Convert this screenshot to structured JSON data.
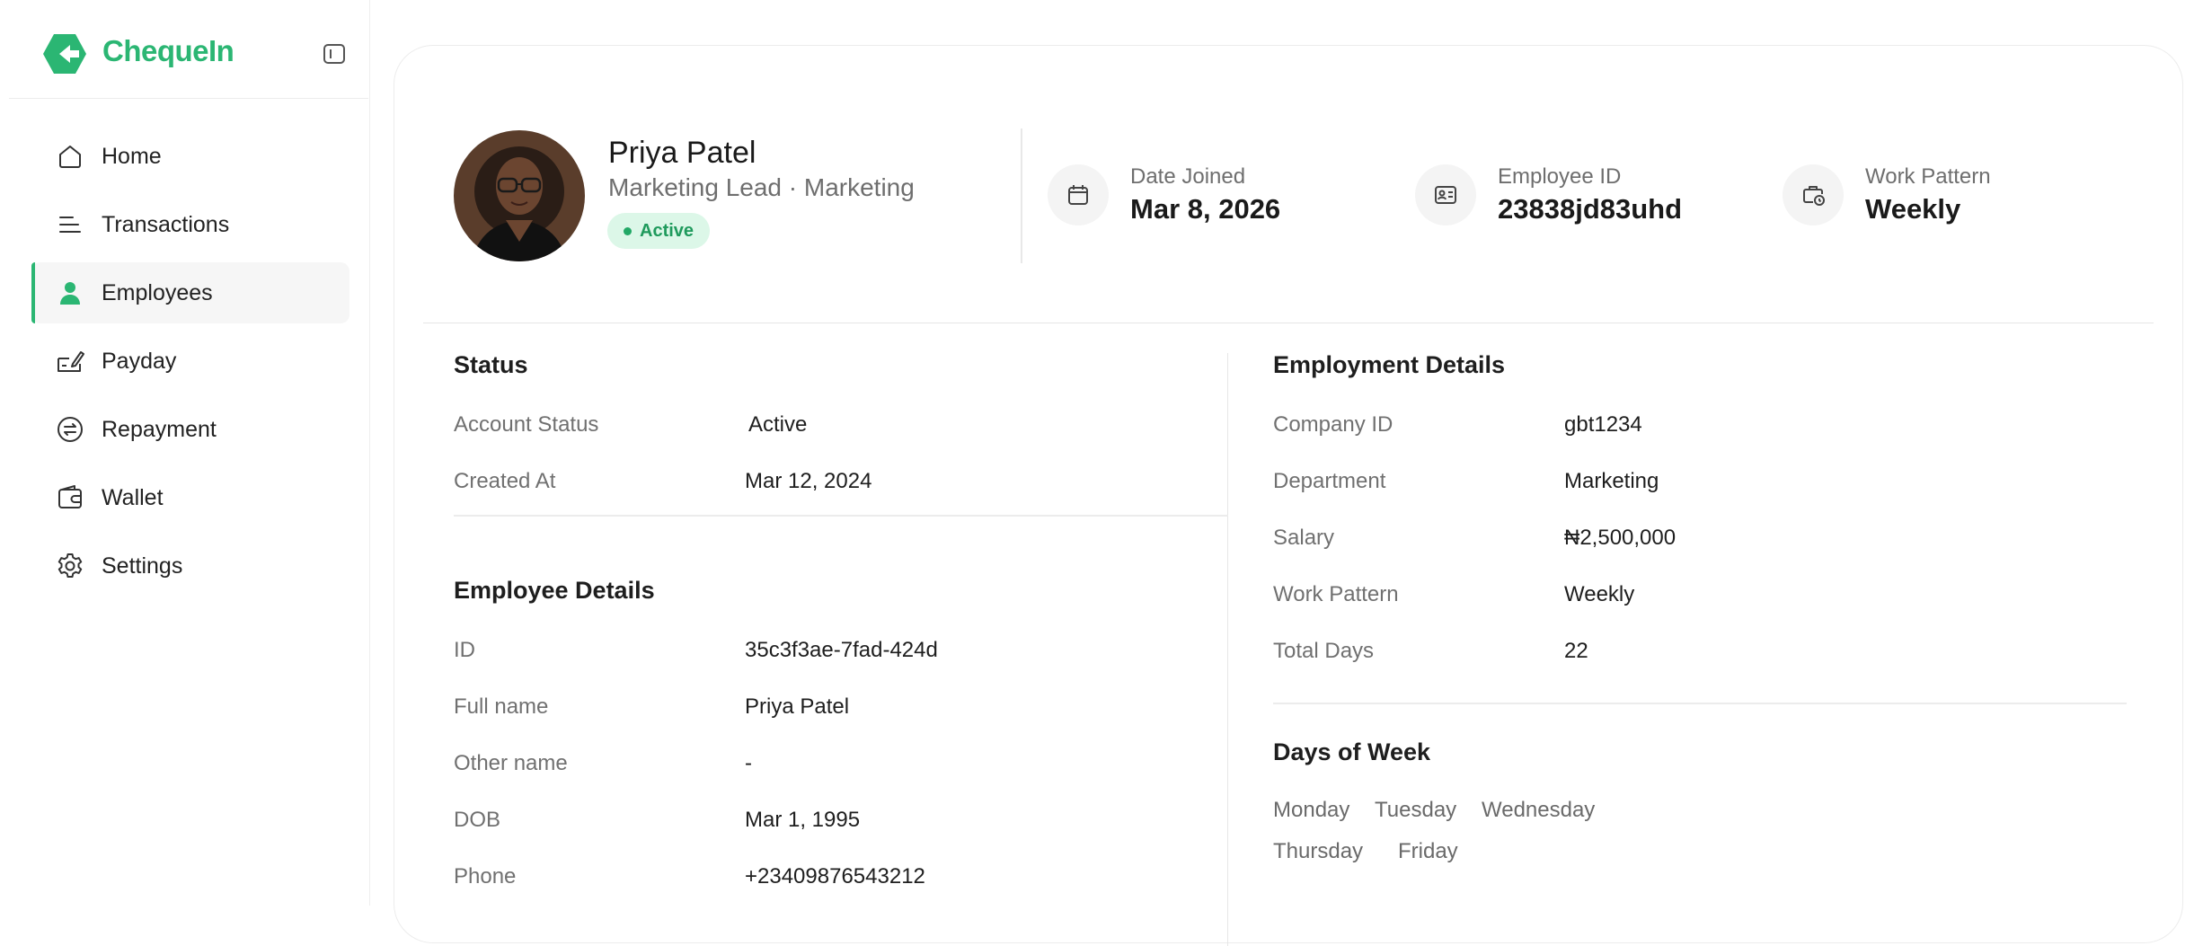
{
  "brand": {
    "name": "ChequeIn",
    "color": "#2bb673"
  },
  "sidebar": {
    "items": [
      {
        "label": "Home",
        "icon": "home-icon"
      },
      {
        "label": "Transactions",
        "icon": "list-icon"
      },
      {
        "label": "Employees",
        "icon": "user-icon",
        "active": true
      },
      {
        "label": "Payday",
        "icon": "cheque-icon"
      },
      {
        "label": "Repayment",
        "icon": "repayment-icon"
      },
      {
        "label": "Wallet",
        "icon": "wallet-icon"
      },
      {
        "label": "Settings",
        "icon": "gear-icon"
      }
    ]
  },
  "profile": {
    "name": "Priya Patel",
    "role": "Marketing Lead · Marketing",
    "status_badge": "Active",
    "stats": [
      {
        "label": "Date Joined",
        "value": "Mar 8, 2026",
        "icon": "calendar-icon"
      },
      {
        "label": "Employee ID",
        "value": "23838jd83uhd",
        "icon": "id-card-icon"
      },
      {
        "label": "Work Pattern",
        "value": "Weekly",
        "icon": "briefcase-clock-icon"
      }
    ]
  },
  "status": {
    "title": "Status",
    "rows": [
      {
        "label": "Account Status",
        "value": "Active"
      },
      {
        "label": "Created At",
        "value": "Mar 12, 2024"
      }
    ]
  },
  "employee_details": {
    "title": "Employee Details",
    "rows": [
      {
        "label": "ID",
        "value": "35c3f3ae-7fad-424d"
      },
      {
        "label": "Full name",
        "value": "Priya Patel"
      },
      {
        "label": "Other name",
        "value": "-"
      },
      {
        "label": "DOB",
        "value": "Mar 1, 1995"
      },
      {
        "label": "Phone",
        "value": "+23409876543212"
      }
    ]
  },
  "employment_details": {
    "title": "Employment Details",
    "rows": [
      {
        "label": "Company ID",
        "value": "gbt1234"
      },
      {
        "label": "Department",
        "value": "Marketing"
      },
      {
        "label": "Salary",
        "value": "₦2,500,000"
      },
      {
        "label": "Work Pattern",
        "value": "Weekly"
      },
      {
        "label": "Total Days",
        "value": "22"
      }
    ]
  },
  "days_of_week": {
    "title": "Days of Week",
    "days": [
      "Monday",
      "Tuesday",
      "Wednesday",
      "Thursday",
      "Friday"
    ]
  }
}
